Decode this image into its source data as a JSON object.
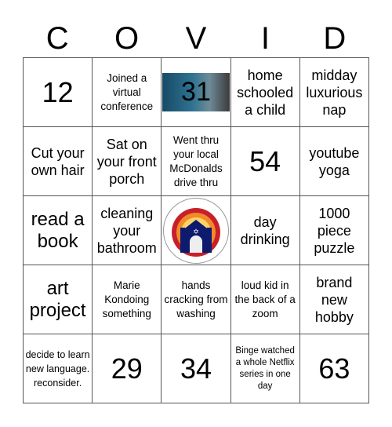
{
  "header": [
    "C",
    "O",
    "V",
    "I",
    "D"
  ],
  "cells": [
    [
      "12",
      "Joined a virtual conference",
      "31",
      "home schooled a child",
      "midday luxurious nap"
    ],
    [
      "Cut your own hair",
      "Sat on your front porch",
      "Went thru your local McDonalds drive thru",
      "54",
      "youtube yoga"
    ],
    [
      "read a book",
      "cleaning your bathroom",
      "",
      "day drinking",
      "1000 piece puzzle"
    ],
    [
      "art project",
      "Marie Kondoing something",
      "hands cracking from washing",
      "loud kid in the back of a zoom",
      "brand new hobby"
    ],
    [
      "decide to learn new language. reconsider.",
      "29",
      "34",
      "Binge watched a whole Netflix series in one day",
      "63"
    ]
  ],
  "free_space_icon": "synagogue-logo-icon"
}
